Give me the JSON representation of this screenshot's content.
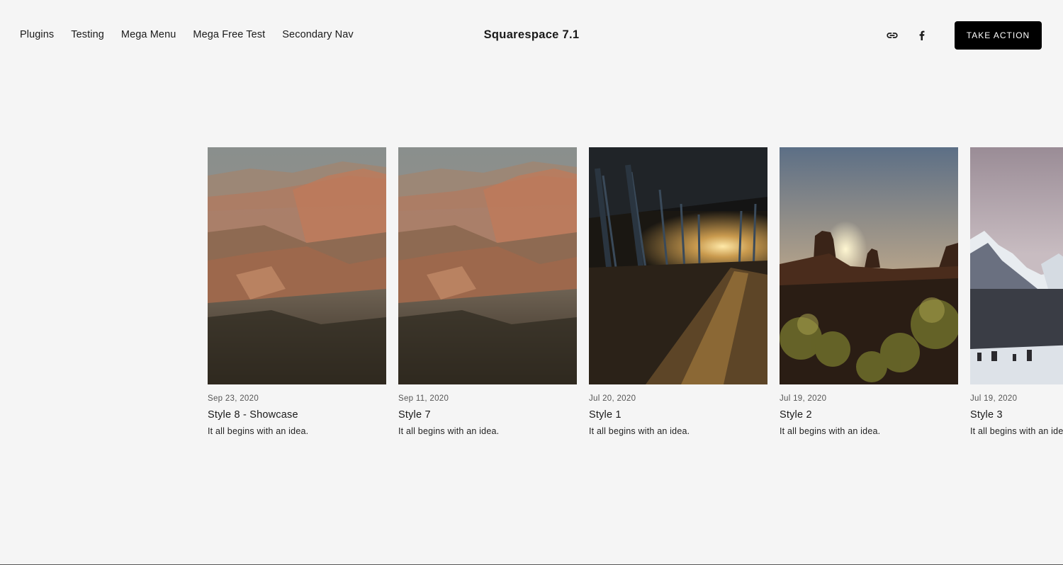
{
  "header": {
    "nav": [
      "Plugins",
      "Testing",
      "Mega Menu",
      "Mega Free Test",
      "Secondary Nav"
    ],
    "site_title": "Squarespace 7.1",
    "social_icons": [
      "link-icon",
      "facebook-icon"
    ],
    "cta_label": "TAKE ACTION"
  },
  "posts": [
    {
      "date": "Sep 23, 2020",
      "title": "Style 8 - Showcase",
      "excerpt": "It all begins with an idea.",
      "image": "grand-canyon"
    },
    {
      "date": "Sep 11, 2020",
      "title": "Style 7",
      "excerpt": "It all begins with an idea.",
      "image": "grand-canyon"
    },
    {
      "date": "Jul 20, 2020",
      "title": "Style 1",
      "excerpt": "It all begins with an idea.",
      "image": "pier-sunset"
    },
    {
      "date": "Jul 19, 2020",
      "title": "Style 2",
      "excerpt": "It all begins with an idea.",
      "image": "desert-buttes-sunset"
    },
    {
      "date": "Jul 19, 2020",
      "title": "Style 3",
      "excerpt": "It all begins with an idea.",
      "image": "snowy-fjord"
    }
  ],
  "colors": {
    "background": "#f5f5f5",
    "button": "#000000",
    "text": "#1a1a1a"
  }
}
